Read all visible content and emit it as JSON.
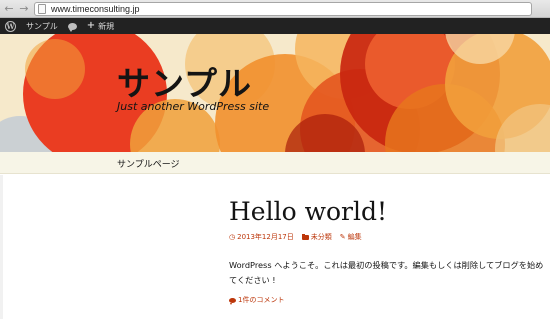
{
  "browser": {
    "back_icon": "back-arrow-icon",
    "forward_icon": "forward-arrow-icon",
    "url": "www.timeconsulting.jp"
  },
  "admin_bar": {
    "logo_icon": "wordpress-logo-icon",
    "logo_text": "W",
    "site_name": "サンプル",
    "comments_icon": "comment-bubble-icon",
    "new_label": "新規"
  },
  "header": {
    "title": "サンプル",
    "description": "Just another WordPress site"
  },
  "nav": {
    "items": [
      "サンプルページ"
    ]
  },
  "post": {
    "title": "Hello world!",
    "date": "2013年12月17日",
    "category": "未分類",
    "edit_label": "編集",
    "body": "WordPress へようこそ。これは最初の投稿です。編集もしくは削除してブログを始めてください !",
    "comments": "1件のコメント"
  },
  "colors": {
    "accent": "#bc360a",
    "admin_bar_bg": "#222222",
    "nav_bg": "#f7f5e7",
    "header_red": "#e8361f",
    "header_orange": "#f29d35"
  }
}
